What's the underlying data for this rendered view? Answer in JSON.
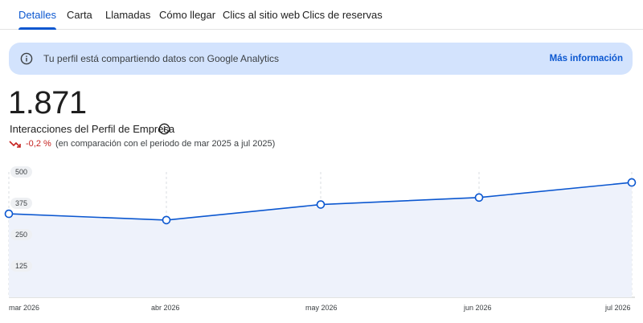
{
  "tabs": [
    {
      "label": "Detalles",
      "active": true
    },
    {
      "label": "Carta",
      "active": false
    },
    {
      "label": "Llamadas",
      "active": false
    },
    {
      "label": "Cómo llegar",
      "active": false
    },
    {
      "label": "Clics al sitio web",
      "active": false
    },
    {
      "label": "Clics de reservas",
      "active": false
    }
  ],
  "banner": {
    "icon": "info-icon",
    "message": "Tu perfil está compartiendo datos con Google Analytics",
    "link_label": "Más información"
  },
  "metric": {
    "value": "1.871",
    "label": "Interacciones del Perfil de Empresa",
    "info_icon": "info-icon",
    "trend_icon": "trending-down-icon",
    "change": "-0,2 %",
    "comparison": "(en comparación con el periodo de mar 2025 a jul 2025)"
  },
  "colors": {
    "accent": "#0b57d0",
    "banner_bg": "#d3e3fd",
    "negative": "#c5221f",
    "line": "#0b57d0",
    "area_fill": "#eef2fb"
  },
  "chart_data": {
    "type": "area",
    "x": [
      "mar 2026",
      "abr 2026",
      "may 2026",
      "jun 2026",
      "jul 2026"
    ],
    "values": [
      333,
      308,
      370,
      398,
      458
    ],
    "yticks": [
      "500",
      "375",
      "250",
      "125"
    ],
    "ylim": [
      0,
      500
    ],
    "grid": "vertical-dashed"
  }
}
